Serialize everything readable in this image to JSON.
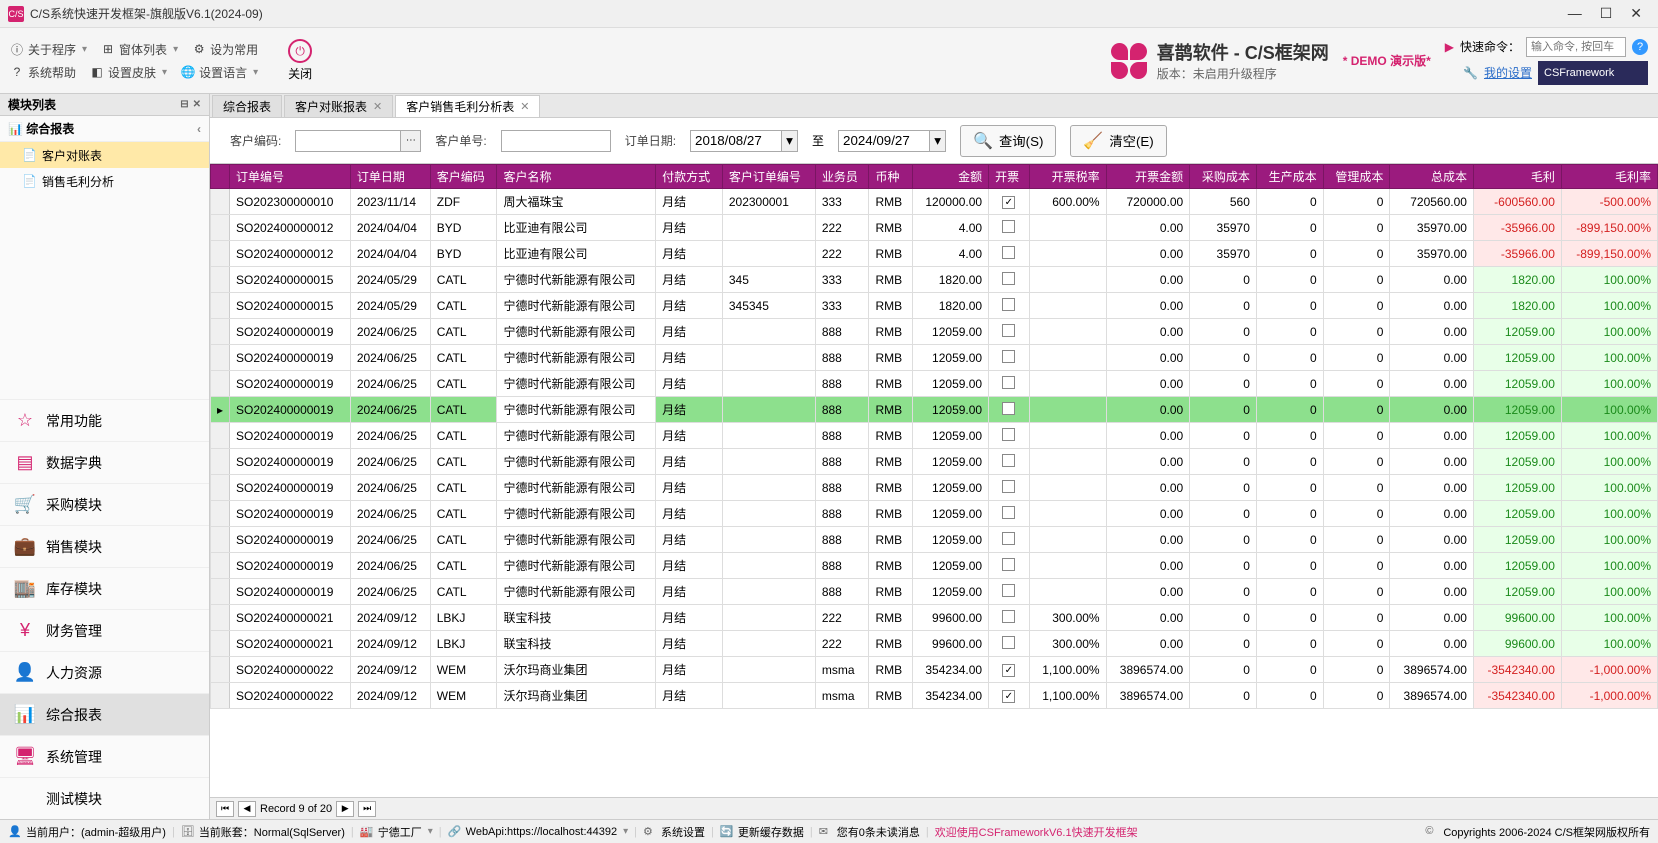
{
  "window": {
    "title": "C/S系统快速开发框架-旗舰版V6.1(2024-09)"
  },
  "toolbar": {
    "about": "关于程序",
    "winlist": "窗体列表",
    "setcommon": "设为常用",
    "syshelp": "系统帮助",
    "setskin": "设置皮肤",
    "setlang": "设置语言",
    "close": "关闭"
  },
  "brand": {
    "title": "喜鹊软件 - C/S框架网",
    "sub": "版本：未启用升级程序",
    "demo": "* DEMO 演示版*"
  },
  "quick": {
    "label": "快速命令：",
    "placeholder": "输入命令, 按回车",
    "settings": "我的设置",
    "badge": "CSFramework"
  },
  "sidebar": {
    "title": "模块列表",
    "tree_title": "综合报表",
    "tree_items": [
      {
        "label": "客户对账表",
        "active": true
      },
      {
        "label": "销售毛利分析",
        "active": false
      }
    ],
    "modules": [
      {
        "label": "常用功能",
        "icon": "☆"
      },
      {
        "label": "数据字典",
        "icon": "▤"
      },
      {
        "label": "采购模块",
        "icon": "🛒"
      },
      {
        "label": "销售模块",
        "icon": "💼"
      },
      {
        "label": "库存模块",
        "icon": "🏬"
      },
      {
        "label": "财务管理",
        "icon": "¥"
      },
      {
        "label": "人力资源",
        "icon": "👤"
      },
      {
        "label": "综合报表",
        "icon": "📊",
        "active": true
      },
      {
        "label": "系统管理",
        "icon": "🖥"
      },
      {
        "label": "测试模块",
        "icon": "</>"
      }
    ]
  },
  "tabs": [
    {
      "label": "综合报表",
      "closable": false
    },
    {
      "label": "客户对账报表",
      "closable": true
    },
    {
      "label": "客户销售毛利分析表",
      "closable": true,
      "active": true
    }
  ],
  "filter": {
    "cust_code_label": "客户编码:",
    "cust_no_label": "客户单号:",
    "order_date_label": "订单日期:",
    "to": "至",
    "date_from": "2018/08/27",
    "date_to": "2024/09/27",
    "query": "查询(S)",
    "clear": "清空(E)"
  },
  "columns": [
    "订单编号",
    "订单日期",
    "客户编码",
    "客户名称",
    "付款方式",
    "客户订单编号",
    "业务员",
    "币种",
    "金额",
    "开票",
    "开票税率",
    "开票金额",
    "采购成本",
    "生产成本",
    "管理成本",
    "总成本",
    "毛利",
    "毛利率"
  ],
  "rows": [
    {
      "no": "SO202300000010",
      "date": "2023/11/14",
      "code": "ZDF",
      "name": "周大福珠宝",
      "pay": "月结",
      "cono": "202300001",
      "sales": "333",
      "cur": "RMB",
      "amt": "120000.00",
      "inv": true,
      "tax": "600.00%",
      "invamt": "720000.00",
      "pcost": "560",
      "mcost": "0",
      "acost": "0",
      "tcost": "720560.00",
      "gp": "-600560.00",
      "gpr": "-500.00%",
      "neg": true
    },
    {
      "no": "SO202400000012",
      "date": "2024/04/04",
      "code": "BYD",
      "name": "比亚迪有限公司",
      "pay": "月结",
      "cono": "",
      "sales": "222",
      "cur": "RMB",
      "amt": "4.00",
      "inv": false,
      "tax": "",
      "invamt": "0.00",
      "pcost": "35970",
      "mcost": "0",
      "acost": "0",
      "tcost": "35970.00",
      "gp": "-35966.00",
      "gpr": "-899,150.00%",
      "neg": true
    },
    {
      "no": "SO202400000012",
      "date": "2024/04/04",
      "code": "BYD",
      "name": "比亚迪有限公司",
      "pay": "月结",
      "cono": "",
      "sales": "222",
      "cur": "RMB",
      "amt": "4.00",
      "inv": false,
      "tax": "",
      "invamt": "0.00",
      "pcost": "35970",
      "mcost": "0",
      "acost": "0",
      "tcost": "35970.00",
      "gp": "-35966.00",
      "gpr": "-899,150.00%",
      "neg": true
    },
    {
      "no": "SO202400000015",
      "date": "2024/05/29",
      "code": "CATL",
      "name": "宁德时代新能源有限公司",
      "pay": "月结",
      "cono": "345",
      "sales": "333",
      "cur": "RMB",
      "amt": "1820.00",
      "inv": false,
      "tax": "",
      "invamt": "0.00",
      "pcost": "0",
      "mcost": "0",
      "acost": "0",
      "tcost": "0.00",
      "gp": "1820.00",
      "gpr": "100.00%"
    },
    {
      "no": "SO202400000015",
      "date": "2024/05/29",
      "code": "CATL",
      "name": "宁德时代新能源有限公司",
      "pay": "月结",
      "cono": "345345",
      "sales": "333",
      "cur": "RMB",
      "amt": "1820.00",
      "inv": false,
      "tax": "",
      "invamt": "0.00",
      "pcost": "0",
      "mcost": "0",
      "acost": "0",
      "tcost": "0.00",
      "gp": "1820.00",
      "gpr": "100.00%"
    },
    {
      "no": "SO202400000019",
      "date": "2024/06/25",
      "code": "CATL",
      "name": "宁德时代新能源有限公司",
      "pay": "月结",
      "cono": "",
      "sales": "888",
      "cur": "RMB",
      "amt": "12059.00",
      "inv": false,
      "tax": "",
      "invamt": "0.00",
      "pcost": "0",
      "mcost": "0",
      "acost": "0",
      "tcost": "0.00",
      "gp": "12059.00",
      "gpr": "100.00%"
    },
    {
      "no": "SO202400000019",
      "date": "2024/06/25",
      "code": "CATL",
      "name": "宁德时代新能源有限公司",
      "pay": "月结",
      "cono": "",
      "sales": "888",
      "cur": "RMB",
      "amt": "12059.00",
      "inv": false,
      "tax": "",
      "invamt": "0.00",
      "pcost": "0",
      "mcost": "0",
      "acost": "0",
      "tcost": "0.00",
      "gp": "12059.00",
      "gpr": "100.00%"
    },
    {
      "no": "SO202400000019",
      "date": "2024/06/25",
      "code": "CATL",
      "name": "宁德时代新能源有限公司",
      "pay": "月结",
      "cono": "",
      "sales": "888",
      "cur": "RMB",
      "amt": "12059.00",
      "inv": false,
      "tax": "",
      "invamt": "0.00",
      "pcost": "0",
      "mcost": "0",
      "acost": "0",
      "tcost": "0.00",
      "gp": "12059.00",
      "gpr": "100.00%"
    },
    {
      "no": "SO202400000019",
      "date": "2024/06/25",
      "code": "CATL",
      "name": "宁德时代新能源有限公司",
      "pay": "月结",
      "cono": "",
      "sales": "888",
      "cur": "RMB",
      "amt": "12059.00",
      "inv": false,
      "tax": "",
      "invamt": "0.00",
      "pcost": "0",
      "mcost": "0",
      "acost": "0",
      "tcost": "0.00",
      "gp": "12059.00",
      "gpr": "100.00%",
      "sel": true
    },
    {
      "no": "SO202400000019",
      "date": "2024/06/25",
      "code": "CATL",
      "name": "宁德时代新能源有限公司",
      "pay": "月结",
      "cono": "",
      "sales": "888",
      "cur": "RMB",
      "amt": "12059.00",
      "inv": false,
      "tax": "",
      "invamt": "0.00",
      "pcost": "0",
      "mcost": "0",
      "acost": "0",
      "tcost": "0.00",
      "gp": "12059.00",
      "gpr": "100.00%"
    },
    {
      "no": "SO202400000019",
      "date": "2024/06/25",
      "code": "CATL",
      "name": "宁德时代新能源有限公司",
      "pay": "月结",
      "cono": "",
      "sales": "888",
      "cur": "RMB",
      "amt": "12059.00",
      "inv": false,
      "tax": "",
      "invamt": "0.00",
      "pcost": "0",
      "mcost": "0",
      "acost": "0",
      "tcost": "0.00",
      "gp": "12059.00",
      "gpr": "100.00%"
    },
    {
      "no": "SO202400000019",
      "date": "2024/06/25",
      "code": "CATL",
      "name": "宁德时代新能源有限公司",
      "pay": "月结",
      "cono": "",
      "sales": "888",
      "cur": "RMB",
      "amt": "12059.00",
      "inv": false,
      "tax": "",
      "invamt": "0.00",
      "pcost": "0",
      "mcost": "0",
      "acost": "0",
      "tcost": "0.00",
      "gp": "12059.00",
      "gpr": "100.00%"
    },
    {
      "no": "SO202400000019",
      "date": "2024/06/25",
      "code": "CATL",
      "name": "宁德时代新能源有限公司",
      "pay": "月结",
      "cono": "",
      "sales": "888",
      "cur": "RMB",
      "amt": "12059.00",
      "inv": false,
      "tax": "",
      "invamt": "0.00",
      "pcost": "0",
      "mcost": "0",
      "acost": "0",
      "tcost": "0.00",
      "gp": "12059.00",
      "gpr": "100.00%"
    },
    {
      "no": "SO202400000019",
      "date": "2024/06/25",
      "code": "CATL",
      "name": "宁德时代新能源有限公司",
      "pay": "月结",
      "cono": "",
      "sales": "888",
      "cur": "RMB",
      "amt": "12059.00",
      "inv": false,
      "tax": "",
      "invamt": "0.00",
      "pcost": "0",
      "mcost": "0",
      "acost": "0",
      "tcost": "0.00",
      "gp": "12059.00",
      "gpr": "100.00%"
    },
    {
      "no": "SO202400000019",
      "date": "2024/06/25",
      "code": "CATL",
      "name": "宁德时代新能源有限公司",
      "pay": "月结",
      "cono": "",
      "sales": "888",
      "cur": "RMB",
      "amt": "12059.00",
      "inv": false,
      "tax": "",
      "invamt": "0.00",
      "pcost": "0",
      "mcost": "0",
      "acost": "0",
      "tcost": "0.00",
      "gp": "12059.00",
      "gpr": "100.00%"
    },
    {
      "no": "SO202400000019",
      "date": "2024/06/25",
      "code": "CATL",
      "name": "宁德时代新能源有限公司",
      "pay": "月结",
      "cono": "",
      "sales": "888",
      "cur": "RMB",
      "amt": "12059.00",
      "inv": false,
      "tax": "",
      "invamt": "0.00",
      "pcost": "0",
      "mcost": "0",
      "acost": "0",
      "tcost": "0.00",
      "gp": "12059.00",
      "gpr": "100.00%"
    },
    {
      "no": "SO202400000021",
      "date": "2024/09/12",
      "code": "LBKJ",
      "name": "联宝科技",
      "pay": "月结",
      "cono": "",
      "sales": "222",
      "cur": "RMB",
      "amt": "99600.00",
      "inv": false,
      "tax": "300.00%",
      "invamt": "0.00",
      "pcost": "0",
      "mcost": "0",
      "acost": "0",
      "tcost": "0.00",
      "gp": "99600.00",
      "gpr": "100.00%"
    },
    {
      "no": "SO202400000021",
      "date": "2024/09/12",
      "code": "LBKJ",
      "name": "联宝科技",
      "pay": "月结",
      "cono": "",
      "sales": "222",
      "cur": "RMB",
      "amt": "99600.00",
      "inv": false,
      "tax": "300.00%",
      "invamt": "0.00",
      "pcost": "0",
      "mcost": "0",
      "acost": "0",
      "tcost": "0.00",
      "gp": "99600.00",
      "gpr": "100.00%"
    },
    {
      "no": "SO202400000022",
      "date": "2024/09/12",
      "code": "WEM",
      "name": "沃尔玛商业集团",
      "pay": "月结",
      "cono": "",
      "sales": "msma",
      "cur": "RMB",
      "amt": "354234.00",
      "inv": true,
      "tax": "1,100.00%",
      "invamt": "3896574.00",
      "pcost": "0",
      "mcost": "0",
      "acost": "0",
      "tcost": "3896574.00",
      "gp": "-3542340.00",
      "gpr": "-1,000.00%",
      "neg": true
    },
    {
      "no": "SO202400000022",
      "date": "2024/09/12",
      "code": "WEM",
      "name": "沃尔玛商业集团",
      "pay": "月结",
      "cono": "",
      "sales": "msma",
      "cur": "RMB",
      "amt": "354234.00",
      "inv": true,
      "tax": "1,100.00%",
      "invamt": "3896574.00",
      "pcost": "0",
      "mcost": "0",
      "acost": "0",
      "tcost": "3896574.00",
      "gp": "-3542340.00",
      "gpr": "-1,000.00%",
      "neg": true
    }
  ],
  "nav": {
    "record": "Record 9 of 20"
  },
  "status": {
    "user": "当前用户：(admin-超级用户)",
    "acct": "当前账套：Normal(SqlServer)",
    "factory": "宁德工厂",
    "api": "WebApi:https://localhost:44392",
    "syscfg": "系统设置",
    "cache": "更新缓存数据",
    "msg": "您有0条未读消息",
    "welcome": "欢迎使用CSFrameworkV6.1快速开发框架",
    "copy": "Copyrights 2006-2024 C/S框架网版权所有"
  }
}
